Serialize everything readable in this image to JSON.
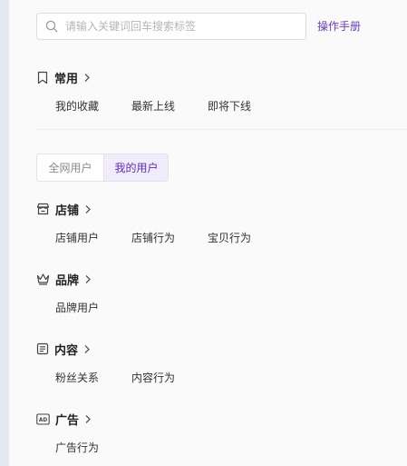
{
  "search": {
    "placeholder": "请输入关键词回车搜索标签"
  },
  "manual_link": "操作手册",
  "common": {
    "title": "常用",
    "items": [
      "我的收藏",
      "最新上线",
      "即将下线"
    ]
  },
  "tabs": [
    "全网用户",
    "我的用户"
  ],
  "shop": {
    "title": "店铺",
    "items": [
      "店铺用户",
      "店铺行为",
      "宝贝行为"
    ]
  },
  "brand": {
    "title": "品牌",
    "items": [
      "品牌用户"
    ]
  },
  "content": {
    "title": "内容",
    "items": [
      "粉丝关系",
      "内容行为"
    ]
  },
  "ads": {
    "title": "广告",
    "items": [
      "广告行为"
    ],
    "icon_text": "AD"
  },
  "colors": {
    "accent": "#6a3dc7",
    "active_tab_bg": "#f1ecfb"
  }
}
